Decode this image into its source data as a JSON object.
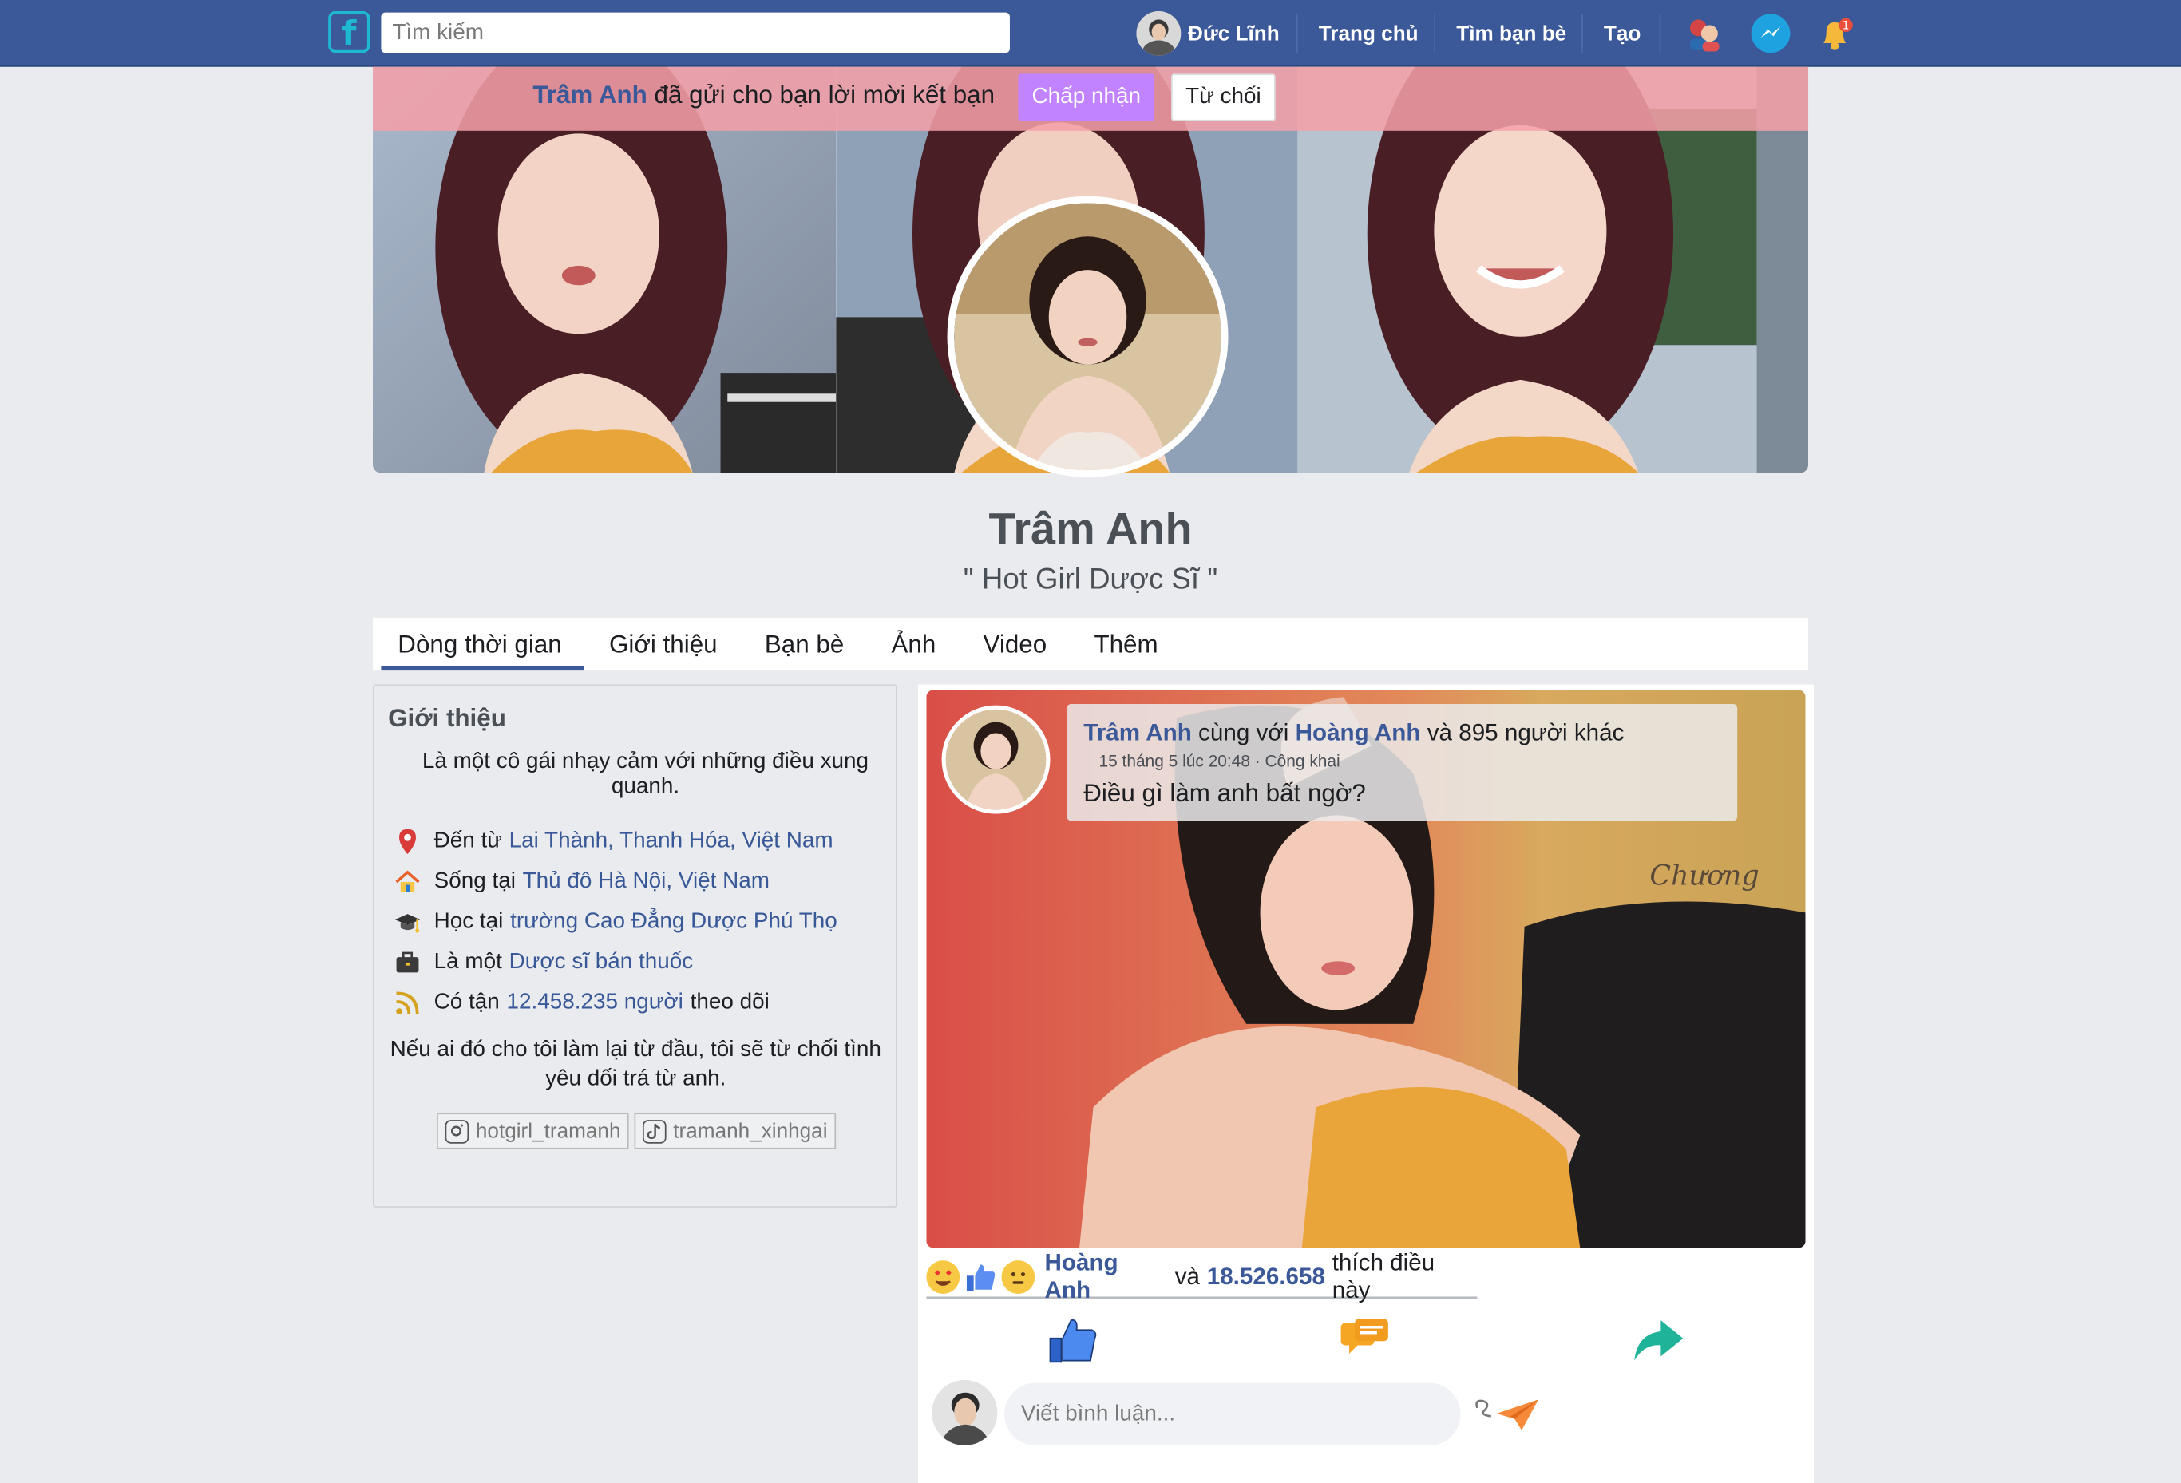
{
  "topbar": {
    "logo_letter": "f",
    "search_placeholder": "Tìm kiếm",
    "user_name": "Đức Lĩnh",
    "nav": [
      "Trang chủ",
      "Tìm bạn bè",
      "Tạo"
    ],
    "notification_badge": "1"
  },
  "friend_request": {
    "name": "Trâm Anh",
    "message": "đã gửi cho bạn lời mời kết bạn",
    "accept_label": "Chấp nhận",
    "reject_label": "Từ chối"
  },
  "profile": {
    "name": "Trâm Anh",
    "bio": "\" Hot Girl Dược Sĩ \""
  },
  "tabs": [
    "Dòng thời gian",
    "Giới thiệu",
    "Bạn bè",
    "Ảnh",
    "Video",
    "Thêm"
  ],
  "intro": {
    "title": "Giới thiệu",
    "description": "Là một cô gái nhạy cảm với những điều xung quanh.",
    "items": [
      {
        "icon": "location-pin-icon",
        "prefix": "Đến từ",
        "link": "Lai Thành, Thanh Hóa, Việt Nam",
        "suffix": ""
      },
      {
        "icon": "house-icon",
        "prefix": "Sống tại",
        "link": "Thủ đô Hà Nội, Việt Nam",
        "suffix": ""
      },
      {
        "icon": "graduation-cap-icon",
        "prefix": "Học tại",
        "link": "trường Cao Đẳng Dược Phú Thọ",
        "suffix": ""
      },
      {
        "icon": "briefcase-icon",
        "prefix": "Là một",
        "link": "Dược sĩ bán thuốc",
        "suffix": ""
      },
      {
        "icon": "rss-feed-icon",
        "prefix": "Có tận",
        "link": "12.458.235 người",
        "suffix": "theo dõi"
      }
    ],
    "quote": "Nếu ai đó cho tôi làm lại từ đầu, tôi sẽ từ chối tình yêu dối trá từ anh.",
    "socials": [
      {
        "icon": "instagram-icon",
        "handle": "hotgirl_tramanh"
      },
      {
        "icon": "tiktok-icon",
        "handle": "tramanh_xinhgai"
      }
    ]
  },
  "post": {
    "author": "Trâm Anh",
    "with_text": "cùng với",
    "tagged": "Hoàng Anh",
    "others": "và 895 người khác",
    "meta": "15 tháng 5 lúc 20:48 · Công khai",
    "text": "Điều gì làm anh bất ngờ?",
    "image_signature": "Chương",
    "reactions": {
      "name": "Hoàng Anh",
      "and": "và",
      "count": "18.526.658",
      "suffix": "thích điều này"
    },
    "comment_placeholder": "Viết bình luận..."
  },
  "colors": {
    "topbar": "#3b5998",
    "link": "#385898",
    "accept": "#c183ff",
    "request_bar": "#f4a0a8",
    "page_bg": "#e9ebee"
  }
}
